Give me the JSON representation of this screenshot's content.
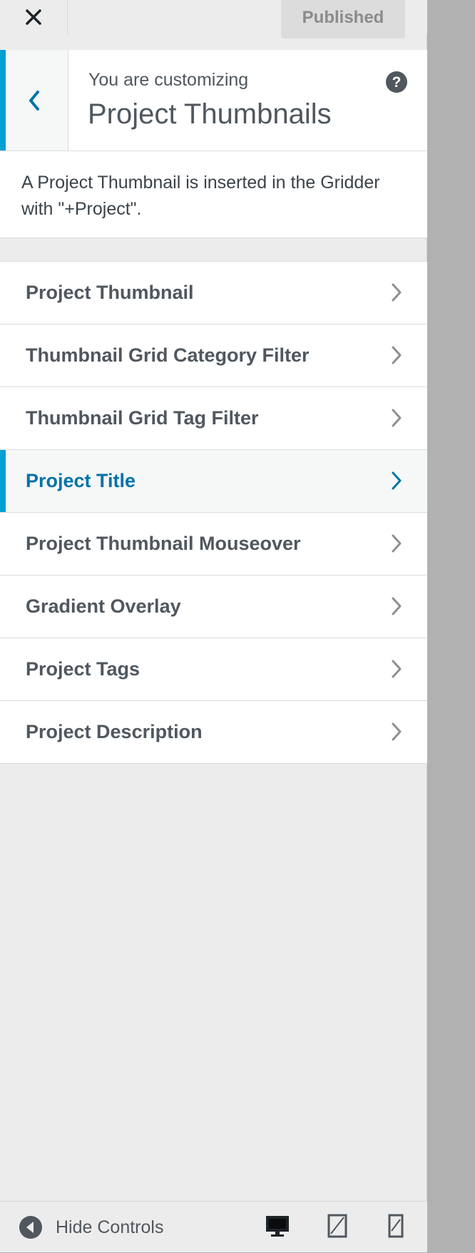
{
  "header": {
    "close_icon": "close-icon",
    "publish_label": "Published"
  },
  "section": {
    "back_icon": "chevron-left-icon",
    "customizing_label": "You are customizing",
    "title": "Project Thumbnails",
    "help_icon": "help-icon",
    "help_glyph": "?",
    "description": "A Project Thumbnail is inserted in the Gridder with \"+Project\"."
  },
  "panels": [
    {
      "label": "Project Thumbnail",
      "active": false
    },
    {
      "label": "Thumbnail Grid Category Filter",
      "active": false
    },
    {
      "label": "Thumbnail Grid Tag Filter",
      "active": false
    },
    {
      "label": "Project Title",
      "active": true
    },
    {
      "label": "Project Thumbnail Mouseover",
      "active": false
    },
    {
      "label": "Gradient Overlay",
      "active": false
    },
    {
      "label": "Project Tags",
      "active": false
    },
    {
      "label": "Project Description",
      "active": false
    }
  ],
  "footer": {
    "hide_controls_label": "Hide Controls",
    "devices": [
      {
        "name": "desktop",
        "icon": "desktop-icon",
        "active": true
      },
      {
        "name": "tablet",
        "icon": "tablet-icon",
        "active": false
      },
      {
        "name": "mobile",
        "icon": "mobile-icon",
        "active": false
      }
    ]
  },
  "colors": {
    "accent": "#00a0d2",
    "active_text": "#0073aa",
    "text": "#50575e",
    "pane_bg": "#ececec",
    "overlay_bg": "#b1b1b1"
  }
}
